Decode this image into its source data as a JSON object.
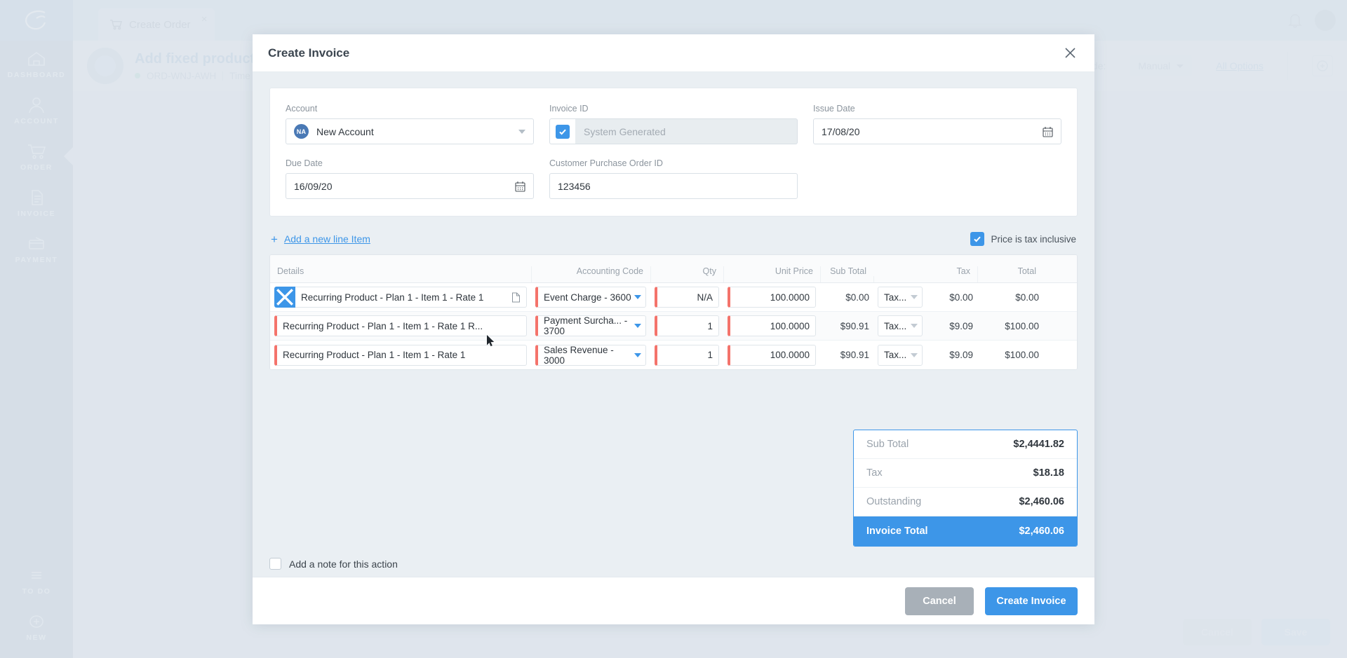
{
  "background": {
    "tab": {
      "label": "Create Order",
      "icon": "cart-icon",
      "close": "×"
    },
    "page": {
      "title": "Add fixed product ( F",
      "order_code": "ORD-WNJ-AWH",
      "timezone_label": "Time Zo",
      "mode_label": "ode:",
      "mode_value": "Manual",
      "all_options": "All Options"
    },
    "sidebar": {
      "items": [
        {
          "label": "DASHBOARD",
          "icon": "home-icon"
        },
        {
          "label": "ACCOUNT",
          "icon": "user-icon"
        },
        {
          "label": "ORDER",
          "icon": "cart-icon"
        },
        {
          "label": "INVOICE",
          "icon": "document-icon"
        },
        {
          "label": "PAYMENT",
          "icon": "card-icon"
        }
      ],
      "bottom_items": [
        {
          "label": "TO DO",
          "icon": "list-icon"
        },
        {
          "label": "NEW",
          "icon": "plus-circle-icon"
        }
      ]
    },
    "footer": {
      "cancel": "Cancel",
      "save": "Save"
    }
  },
  "modal": {
    "title": "Create Invoice",
    "close_icon": "close-icon",
    "form": {
      "account": {
        "label": "Account",
        "badge": "NA",
        "value": "New Account"
      },
      "invoice_id": {
        "label": "Invoice ID",
        "checked": true,
        "placeholder": "System Generated",
        "value": ""
      },
      "issue_date": {
        "label": "Issue Date",
        "value": "17/08/20",
        "icon": "calendar-icon"
      },
      "due_date": {
        "label": "Due Date",
        "value": "16/09/20",
        "icon": "calendar-icon"
      },
      "po_id": {
        "label": "Customer Purchase Order ID",
        "value": "123456"
      }
    },
    "line_items": {
      "add_label": "Add a new line Item",
      "add_icon": "plus-icon",
      "tax_inclusive_label": "Price is tax inclusive",
      "tax_inclusive_checked": true,
      "columns": [
        "Details",
        "Accounting Code",
        "Qty",
        "Unit Price",
        "Sub Total",
        "Tax",
        "Total"
      ],
      "rows": [
        {
          "details": "Recurring Product - Plan 1 - Item 1 - Rate 1",
          "has_doc_icon": true,
          "selected": true,
          "delete_icon": "close-icon",
          "accounting_code": "Event Charge - 3600",
          "qty": "N/A",
          "unit_price": "100.0000",
          "sub_total": "$0.00",
          "tax_select": "Tax...",
          "tax": "$0.00",
          "total": "$0.00"
        },
        {
          "details": "Recurring Product - Plan 1 - Item 1 - Rate 1 R...",
          "has_doc_icon": false,
          "selected": false,
          "accounting_code": "Payment Surcha... - 3700",
          "qty": "1",
          "unit_price": "100.0000",
          "sub_total": "$90.91",
          "tax_select": "Tax...",
          "tax": "$9.09",
          "total": "$100.00"
        },
        {
          "details": "Recurring Product - Plan 1 - Item 1 - Rate 1",
          "has_doc_icon": false,
          "selected": false,
          "accounting_code": "Sales Revenue - 3000",
          "qty": "1",
          "unit_price": "100.0000",
          "sub_total": "$90.91",
          "tax_select": "Tax...",
          "tax": "$9.09",
          "total": "$100.00"
        }
      ]
    },
    "totals": [
      {
        "label": "Sub Total",
        "value": "$2,4441.82",
        "highlight": false
      },
      {
        "label": "Tax",
        "value": "$18.18",
        "highlight": false
      },
      {
        "label": "Outstanding",
        "value": "$2,460.06",
        "highlight": false
      },
      {
        "label": "Invoice Total",
        "value": "$2,460.06",
        "highlight": true
      }
    ],
    "note": {
      "label": "Add a note for this action",
      "checked": false
    },
    "footer": {
      "cancel": "Cancel",
      "submit": "Create Invoice"
    }
  },
  "colors": {
    "accent": "#3d96e8",
    "row_marker": "#f4736b",
    "modal_bg": "#eaeff3",
    "muted_text": "#9aa3ac"
  }
}
